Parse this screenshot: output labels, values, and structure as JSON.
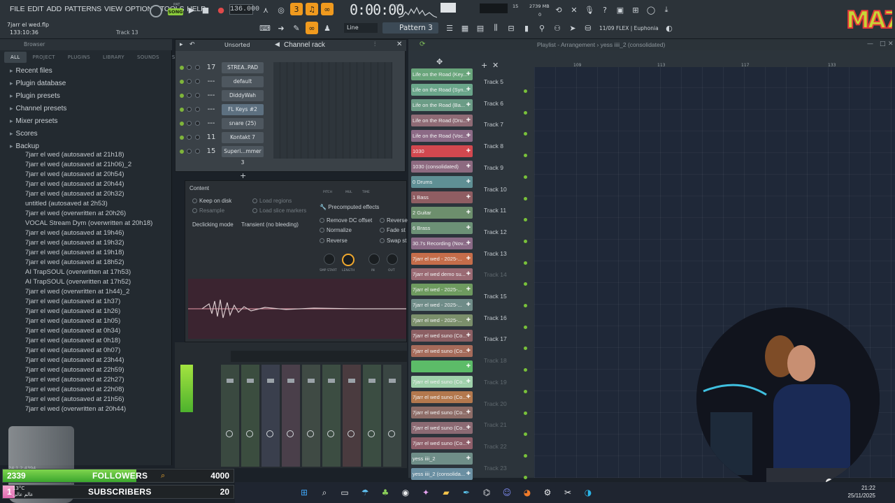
{
  "menu": [
    "FILE",
    "EDIT",
    "ADD",
    "PATTERNS",
    "VIEW",
    "OPTIONS",
    "TOOLS",
    "HELP"
  ],
  "transport": {
    "pat_label": "PAT",
    "song_label": "SONG",
    "tempo": "136.000",
    "time": "0:00:00",
    "time_unit": "M:S:CS",
    "memory_primary": "15",
    "memory_mb": "2739 MB",
    "memory_secondary": "0"
  },
  "hint": {
    "file": "7jarr el wed.flp",
    "time": "133:10:36",
    "track": "Track 13"
  },
  "toolbar2": {
    "snap": "Line",
    "pattern": "Pattern 3",
    "plugin_info": "11/09  FLEX | Euphonia"
  },
  "logo": {
    "text": "MA7"
  },
  "browser": {
    "title": "Browser",
    "tabs": [
      "ALL",
      "PROJECT",
      "PLUGINS",
      "LIBRARY",
      "SOUNDS",
      "STARRED"
    ],
    "folders": [
      {
        "label": "Recent files",
        "icon": "clock-icon"
      },
      {
        "label": "Plugin database",
        "icon": "plug-icon"
      },
      {
        "label": "Plugin presets",
        "icon": "plug-icon"
      },
      {
        "label": "Channel presets",
        "icon": "folder-icon"
      },
      {
        "label": "Mixer presets",
        "icon": "folder-icon"
      },
      {
        "label": "Scores",
        "icon": "note-icon"
      },
      {
        "label": "Backup",
        "icon": "folder-open-icon"
      }
    ],
    "files": [
      "7jarr el wed (autosaved at 21h18)",
      "7jarr el wed (autosaved at 21h06)_2",
      "7jarr el wed (autosaved at 20h54)",
      "7jarr el wed (autosaved at 20h44)",
      "7jarr el wed (autosaved at 20h32)",
      "untitled (autosaved at 2h53)",
      "7jarr el wed (overwritten at 20h26)",
      "VOCAL Stream Dym (overwritten at 20h18)",
      "7jarr el wed (autosaved at 19h46)",
      "7jarr el wed (autosaved at 19h32)",
      "7jarr el wed (autosaved at 19h18)",
      "7jarr el wed (autosaved at 18h52)",
      "AI TrapSOUL (overwritten at 17h53)",
      "AI TrapSOUL (overwritten at 17h52)",
      "7jarr el wed (overwritten at 1h44)_2",
      "7jarr el wed (autosaved at 1h37)",
      "7jarr el wed (autosaved at 1h26)",
      "7jarr el wed (autosaved at 1h05)",
      "7jarr el wed (autosaved at 0h34)",
      "7jarr el wed (autosaved at 0h18)",
      "7jarr el wed (autosaved at 0h07)",
      "7jarr el wed (autosaved at 23h44)",
      "7jarr el wed (autosaved at 22h59)",
      "7jarr el wed (autosaved at 22h27)",
      "7jarr el wed (autosaved at 22h08)",
      "7jarr el wed (autosaved at 21h56)",
      "7jarr el wed (overwritten at 20h44)"
    ],
    "footer_lines": [
      "24.1.2.4394",
      "E\\Documents\\Image-Line\\FL Studio\\Proj...",
      "wed (autosaved at 0h49).flp"
    ]
  },
  "rack": {
    "filter": "Unsorted",
    "title": "Channel rack",
    "channels": [
      {
        "num": "17",
        "name": "STREA..PAD",
        "selected": false
      },
      {
        "num": "---",
        "name": "default",
        "selected": false
      },
      {
        "num": "---",
        "name": "DiddyWah",
        "selected": false
      },
      {
        "num": "---",
        "name": "FL Keys #2",
        "selected": true
      },
      {
        "num": "---",
        "name": "snare (25)",
        "selected": false
      },
      {
        "num": "11",
        "name": "Kontakt 7",
        "selected": false
      },
      {
        "num": "15",
        "name": "Superi...mmer 3",
        "selected": false
      }
    ]
  },
  "sampler": {
    "content": "Content",
    "keep_on_disk": "Keep on disk",
    "resample": "Resample",
    "load_regions": "Load regions",
    "load_slice_markers": "Load slice markers",
    "declicking_label": "Declicking mode",
    "declicking_value": "Transient (no bleeding)",
    "precomputed": "Precomputed effects",
    "remove_dc": "Remove DC offset",
    "normalize": "Normalize",
    "reverse": "Reverse",
    "reverse2": "Reverse",
    "fade_stereo": "Fade st",
    "swap_stereo": "Swap st",
    "knobs": [
      "PITCH",
      "MUL",
      "TIME"
    ],
    "knobs2": [
      "SMP START",
      "LENGTH",
      "IN",
      "OUT"
    ]
  },
  "playlist": {
    "title": "Playlist - Arrangement  ›  yess iiii_2 (consolidated)",
    "ruler": [
      "109",
      "113",
      "117",
      "133"
    ],
    "patterns": [
      {
        "name": "Life on the Road (Key...",
        "color": "#69a57b"
      },
      {
        "name": "Life on the Road (Syn...",
        "color": "#6aa58a"
      },
      {
        "name": "Life on the Road (Ba...",
        "color": "#6b9c86"
      },
      {
        "name": "Life on the Road (Dru...",
        "color": "#8f6b75"
      },
      {
        "name": "Life on the Road (Voc...",
        "color": "#8c6a86"
      },
      {
        "name": "1030",
        "color": "#d2484f"
      },
      {
        "name": "1030 (consolidated)",
        "color": "#8d6a80"
      },
      {
        "name": "0 Drums",
        "color": "#5f8f94"
      },
      {
        "name": "1 Bass",
        "color": "#8f5d62"
      },
      {
        "name": "2 Guitar",
        "color": "#6d8f6d"
      },
      {
        "name": "6 Brass",
        "color": "#6c9176"
      },
      {
        "name": "30.7s Recording (Nov...",
        "color": "#8a6a86"
      },
      {
        "name": "7jarr el wed - 2025-...",
        "color": "#c56d4a"
      },
      {
        "name": "7jarr el wed demo su...",
        "color": "#9a6a73"
      },
      {
        "name": "7jarr el wed - 2025-...",
        "color": "#6e9a5f"
      },
      {
        "name": "7jarr el wed - 2025-...",
        "color": "#6f8c88"
      },
      {
        "name": "7jarr el wed - 2025-...",
        "color": "#7b8f6b"
      },
      {
        "name": "7jarr el wed suno (Co...",
        "color": "#8c5f63"
      },
      {
        "name": "7jarr el wed suno (Co...",
        "color": "#a56b5a"
      },
      {
        "name": "",
        "color": "#5cbc68"
      },
      {
        "name": "7jarr el wed suno (Co...",
        "color": "#9fd0aa"
      },
      {
        "name": "7jarr el wed suno (Co...",
        "color": "#b3784d"
      },
      {
        "name": "7jarr el wed suno (Co...",
        "color": "#8e6d68"
      },
      {
        "name": "7jarr el wed suno (Co...",
        "color": "#8c6a73"
      },
      {
        "name": "7jarr el wed suno (Co...",
        "color": "#8f5f6a"
      },
      {
        "name": "yess iiii_2",
        "color": "#6f8e88"
      },
      {
        "name": "yess iiii_2 (consolida...",
        "color": "#6a8fa2"
      }
    ],
    "tracks": [
      "Track 5",
      "Track 6",
      "Track 7",
      "Track 8",
      "Track 9",
      "Track 10",
      "Track 11",
      "Track 12",
      "Track 13",
      "Track 14",
      "Track 15",
      "Track 16",
      "Track 17",
      "Track 18",
      "Track 19",
      "Track 20",
      "Track 21",
      "Track 22",
      "Track 23"
    ]
  },
  "stats": {
    "followers_current": "2339",
    "followers_label": "FOLLOWERS",
    "followers_goal": "4000",
    "followers_progress": 0.58,
    "subscribers_current": "1",
    "subscribers_label": "SUBSCRIBERS",
    "subscribers_goal": "20",
    "subscribers_progress": 0.05
  },
  "weather": {
    "temp": "13°C",
    "place": "عالم عالي"
  },
  "clock": {
    "time": "21:22",
    "date": "25/11/2025"
  }
}
